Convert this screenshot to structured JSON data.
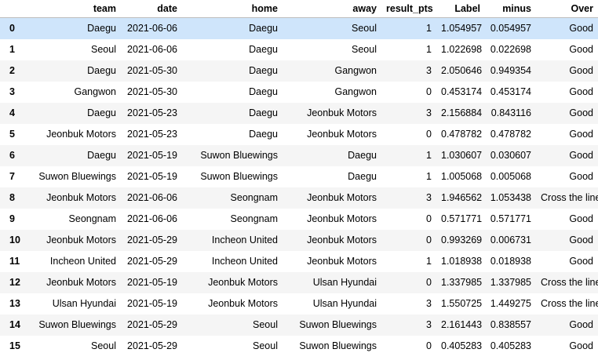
{
  "columns": [
    "",
    "team",
    "date",
    "home",
    "away",
    "result_pts",
    "Label",
    "minus",
    "Over"
  ],
  "selected_row": 0,
  "colors": {
    "selected": "#cfe5fb",
    "stripe": "#f5f5f5"
  },
  "rows": [
    [
      "0",
      "Daegu",
      "2021-06-06",
      "Daegu",
      "Seoul",
      "1",
      "1.054957",
      "0.054957",
      "Good"
    ],
    [
      "1",
      "Seoul",
      "2021-06-06",
      "Daegu",
      "Seoul",
      "1",
      "1.022698",
      "0.022698",
      "Good"
    ],
    [
      "2",
      "Daegu",
      "2021-05-30",
      "Daegu",
      "Gangwon",
      "3",
      "2.050646",
      "0.949354",
      "Good"
    ],
    [
      "3",
      "Gangwon",
      "2021-05-30",
      "Daegu",
      "Gangwon",
      "0",
      "0.453174",
      "0.453174",
      "Good"
    ],
    [
      "4",
      "Daegu",
      "2021-05-23",
      "Daegu",
      "Jeonbuk Motors",
      "3",
      "2.156884",
      "0.843116",
      "Good"
    ],
    [
      "5",
      "Jeonbuk Motors",
      "2021-05-23",
      "Daegu",
      "Jeonbuk Motors",
      "0",
      "0.478782",
      "0.478782",
      "Good"
    ],
    [
      "6",
      "Daegu",
      "2021-05-19",
      "Suwon Bluewings",
      "Daegu",
      "1",
      "1.030607",
      "0.030607",
      "Good"
    ],
    [
      "7",
      "Suwon Bluewings",
      "2021-05-19",
      "Suwon Bluewings",
      "Daegu",
      "1",
      "1.005068",
      "0.005068",
      "Good"
    ],
    [
      "8",
      "Jeonbuk Motors",
      "2021-06-06",
      "Seongnam",
      "Jeonbuk Motors",
      "3",
      "1.946562",
      "1.053438",
      "Cross the line"
    ],
    [
      "9",
      "Seongnam",
      "2021-06-06",
      "Seongnam",
      "Jeonbuk Motors",
      "0",
      "0.571771",
      "0.571771",
      "Good"
    ],
    [
      "10",
      "Jeonbuk Motors",
      "2021-05-29",
      "Incheon United",
      "Jeonbuk Motors",
      "0",
      "0.993269",
      "0.006731",
      "Good"
    ],
    [
      "11",
      "Incheon United",
      "2021-05-29",
      "Incheon United",
      "Jeonbuk Motors",
      "1",
      "1.018938",
      "0.018938",
      "Good"
    ],
    [
      "12",
      "Jeonbuk Motors",
      "2021-05-19",
      "Jeonbuk Motors",
      "Ulsan Hyundai",
      "0",
      "1.337985",
      "1.337985",
      "Cross the line"
    ],
    [
      "13",
      "Ulsan Hyundai",
      "2021-05-19",
      "Jeonbuk Motors",
      "Ulsan Hyundai",
      "3",
      "1.550725",
      "1.449275",
      "Cross the line"
    ],
    [
      "14",
      "Suwon Bluewings",
      "2021-05-29",
      "Seoul",
      "Suwon Bluewings",
      "3",
      "2.161443",
      "0.838557",
      "Good"
    ],
    [
      "15",
      "Seoul",
      "2021-05-29",
      "Seoul",
      "Suwon Bluewings",
      "0",
      "0.405283",
      "0.405283",
      "Good"
    ]
  ]
}
